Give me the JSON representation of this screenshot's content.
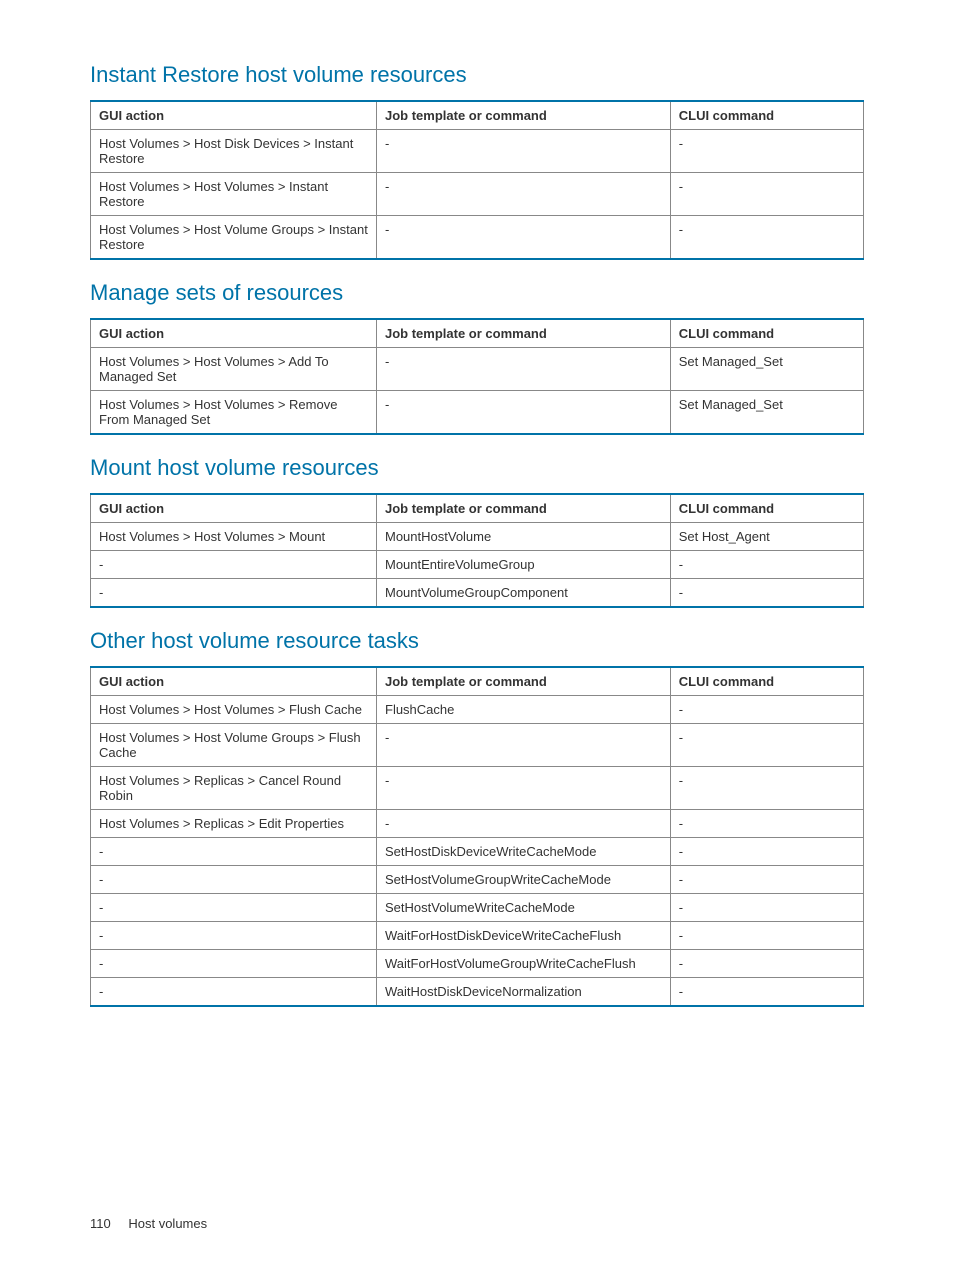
{
  "sections": [
    {
      "title": "Instant Restore host volume resources",
      "headers": [
        "GUI action",
        "Job template or command",
        "CLUI command"
      ],
      "rows": [
        [
          "Host Volumes > Host Disk Devices > Instant Restore",
          "-",
          "-"
        ],
        [
          "Host Volumes > Host Volumes > Instant Restore",
          "-",
          "-"
        ],
        [
          "Host Volumes > Host Volume Groups > Instant Restore",
          "-",
          "-"
        ]
      ]
    },
    {
      "title": "Manage sets of resources",
      "headers": [
        "GUI action",
        "Job template or command",
        "CLUI command"
      ],
      "rows": [
        [
          "Host Volumes > Host Volumes > Add To Managed Set",
          "-",
          "Set Managed_Set"
        ],
        [
          "Host Volumes > Host Volumes > Remove From Managed Set",
          "-",
          "Set Managed_Set"
        ]
      ]
    },
    {
      "title": "Mount host volume resources",
      "headers": [
        "GUI action",
        "Job template or command",
        "CLUI command"
      ],
      "rows": [
        [
          "Host Volumes > Host Volumes > Mount",
          "MountHostVolume",
          "Set Host_Agent"
        ],
        [
          "-",
          "MountEntireVolumeGroup",
          "-"
        ],
        [
          "-",
          "MountVolumeGroupComponent",
          "-"
        ]
      ]
    },
    {
      "title": "Other host volume resource tasks",
      "headers": [
        "GUI action",
        "Job template or command",
        "CLUI command"
      ],
      "rows": [
        [
          "Host Volumes > Host Volumes > Flush Cache",
          "FlushCache",
          "-"
        ],
        [
          "Host Volumes > Host Volume Groups > Flush Cache",
          "-",
          "-"
        ],
        [
          "Host Volumes > Replicas > Cancel Round Robin",
          "-",
          "-"
        ],
        [
          "Host Volumes > Replicas > Edit Properties",
          "-",
          "-"
        ],
        [
          "-",
          "SetHostDiskDeviceWriteCacheMode",
          "-"
        ],
        [
          "-",
          "SetHostVolumeGroupWriteCacheMode",
          "-"
        ],
        [
          "-",
          "SetHostVolumeWriteCacheMode",
          "-"
        ],
        [
          "-",
          "WaitForHostDiskDeviceWriteCacheFlush",
          "-"
        ],
        [
          "-",
          "WaitForHostVolumeGroupWriteCacheFlush",
          "-"
        ],
        [
          "-",
          "WaitHostDiskDeviceNormalization",
          "-"
        ]
      ]
    }
  ],
  "footer": {
    "page": "110",
    "title": "Host volumes"
  }
}
